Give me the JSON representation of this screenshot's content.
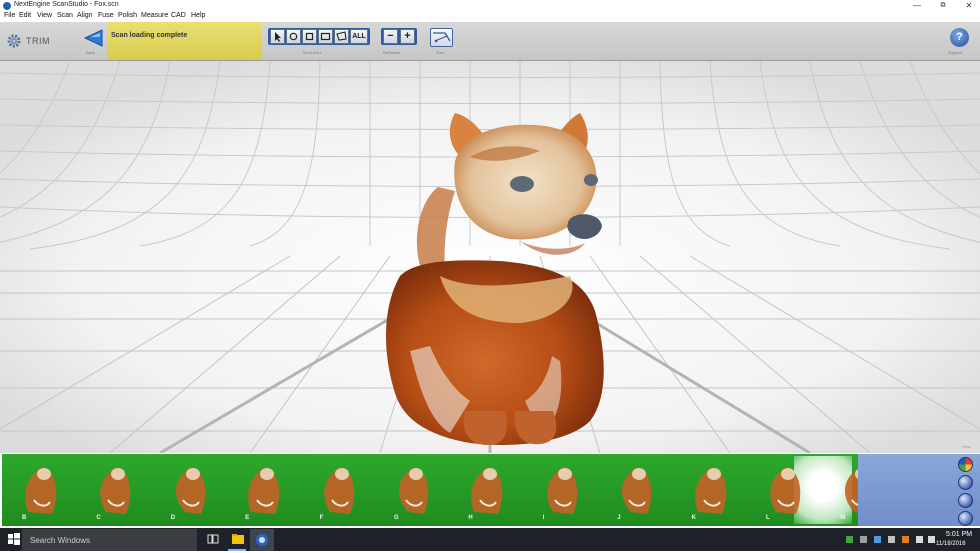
{
  "window": {
    "title": "NextEngine ScanStudio - Fox.scn",
    "controls": [
      "—",
      "⧉",
      "✕"
    ]
  },
  "menu": [
    "File",
    "Edit",
    "View",
    "Scan",
    "Align",
    "Fuse",
    "Polish",
    "Measure",
    "CAD",
    "Help"
  ],
  "toolbar": {
    "mode_label": "TRIM",
    "back_caption": "Back",
    "status": "Scan loading complete",
    "selector_caption": "Selector",
    "selector_all_label": "ALL",
    "deselect_caption": "De/Select",
    "minus_label": "−",
    "plus_label": "+",
    "trim_caption": "Trim",
    "help_label": "?",
    "help_caption": "Support"
  },
  "viewport": {
    "view_label": "View"
  },
  "thumbnails": [
    "B",
    "C",
    "D",
    "E",
    "F",
    "G",
    "H",
    "I",
    "J",
    "K",
    "L",
    "M"
  ],
  "thumbnail_selected": "M",
  "taskbar": {
    "search_placeholder": "Search Windows",
    "time": "5:01 PM",
    "date": "11/18/2016"
  },
  "colors": {
    "thumb_strip": "#2da82d",
    "status_panel": "#e2d65e",
    "fox_orange": "#c8591d",
    "selector_blue": "#2f5aa0"
  }
}
